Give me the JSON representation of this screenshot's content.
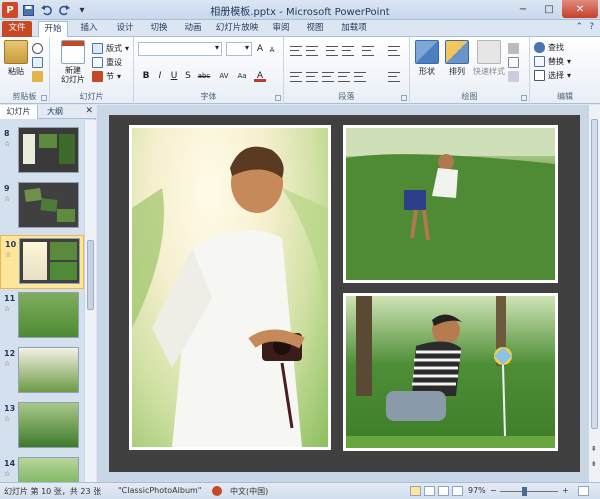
{
  "app": {
    "title": "相册模板.pptx - Microsoft PowerPoint",
    "logo_letter": "P"
  },
  "qat": {
    "icons": [
      "save-icon",
      "undo-icon",
      "redo-icon",
      "customize-icon"
    ]
  },
  "window": {
    "min": "−",
    "max": "□",
    "close": "✕"
  },
  "tabs": [
    {
      "label": "文件"
    },
    {
      "label": "开始"
    },
    {
      "label": "插入"
    },
    {
      "label": "设计"
    },
    {
      "label": "切换"
    },
    {
      "label": "动画"
    },
    {
      "label": "幻灯片放映"
    },
    {
      "label": "审阅"
    },
    {
      "label": "视图"
    },
    {
      "label": "加载项"
    }
  ],
  "ribbon": {
    "clipboard": {
      "paste": "粘贴",
      "label": "剪贴板"
    },
    "slides": {
      "new_slide": "新建\n幻灯片",
      "layout": "版式",
      "reset": "重设",
      "section": "节",
      "label": "幻灯片"
    },
    "font": {
      "label": "字体",
      "buttons": [
        "B",
        "I",
        "U",
        "S",
        "abc",
        "AV",
        "Aa"
      ]
    },
    "paragraph": {
      "label": "段落"
    },
    "drawing": {
      "shape": "形状",
      "arrange": "排列",
      "quick_styles": "快速样式",
      "label": "绘图"
    },
    "editing": {
      "find": "查找",
      "replace": "替换",
      "select": "选择",
      "label": "编辑"
    }
  },
  "left_pane": {
    "tab_slides": "幻灯片",
    "tab_outline": "大纲",
    "close": "✕",
    "thumbnails": [
      {
        "num": "8",
        "star": "☆"
      },
      {
        "num": "9",
        "star": "☆"
      },
      {
        "num": "10",
        "star": "☆"
      },
      {
        "num": "11",
        "star": "☆"
      },
      {
        "num": "12",
        "star": "☆"
      },
      {
        "num": "13",
        "star": "☆"
      },
      {
        "num": "14",
        "star": "☆"
      }
    ],
    "selected_slide": "10"
  },
  "status": {
    "slide_info": "幻灯片 第 10 张，共 23 张",
    "theme": "\"ClassicPhotoAlbum\"",
    "language": "中文(中国)",
    "zoom": "97%",
    "zoom_minus": "−",
    "zoom_plus": "+"
  },
  "colors": {
    "file_tab": "#c74825",
    "slide_bg": "#404040",
    "selected_thumb": "#fde59c"
  }
}
